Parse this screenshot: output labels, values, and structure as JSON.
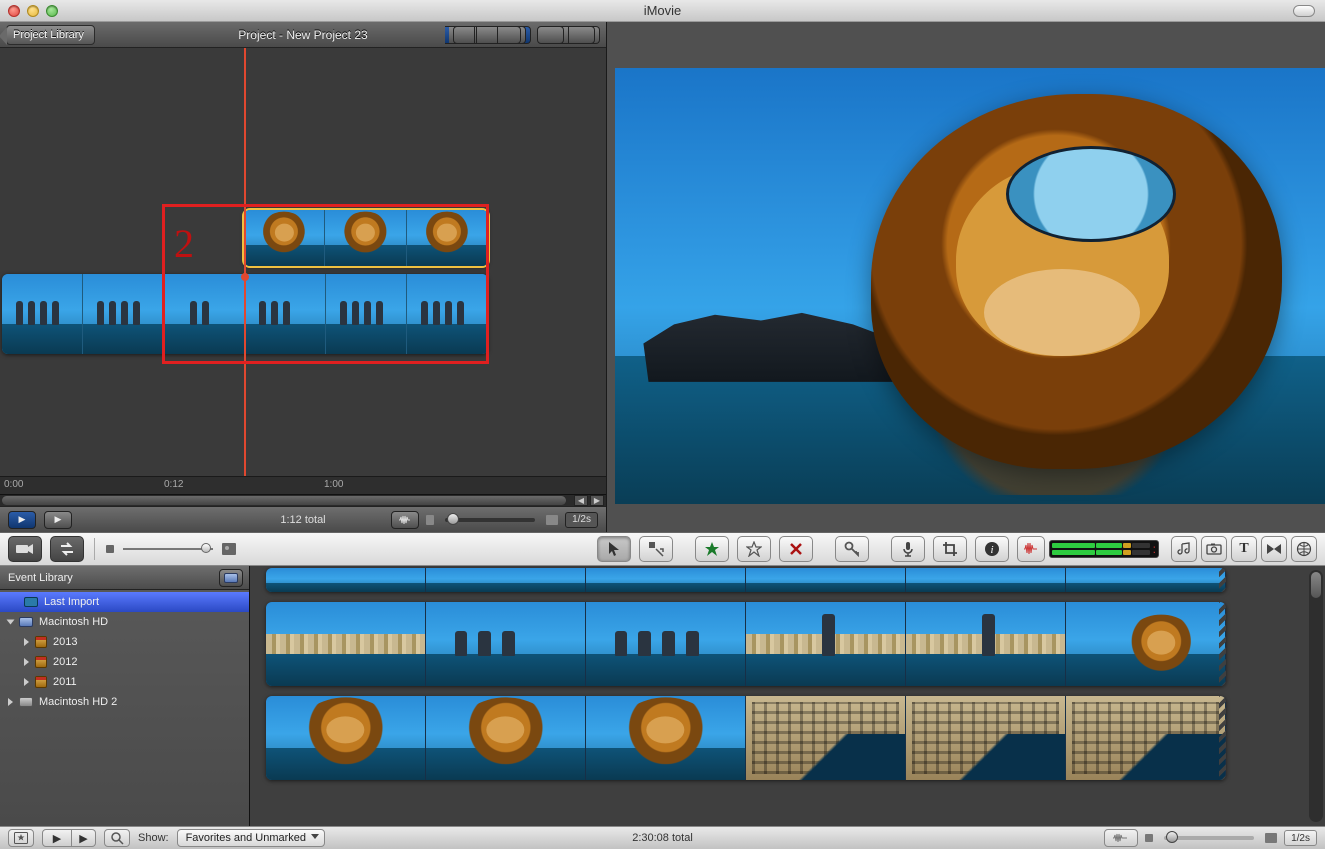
{
  "window": {
    "title": "iMovie"
  },
  "project_header": {
    "back_label": "Project Library",
    "title": "Project - New Project 23"
  },
  "timeline": {
    "ruler": {
      "t0": "0:00",
      "t1": "0:12",
      "t2": "1:00"
    },
    "annotation_number": "2"
  },
  "project_footer": {
    "total_label": "1:12 total",
    "zoom_label": "1/2s"
  },
  "event_sidebar": {
    "title": "Event Library",
    "items": {
      "last_import": "Last Import",
      "mac_hd": "Macintosh HD",
      "y2013": "2013",
      "y2012": "2012",
      "y2011": "2011",
      "mac_hd2": "Macintosh HD 2"
    }
  },
  "bottom_bar": {
    "show_label": "Show:",
    "filter_value": "Favorites and Unmarked",
    "total_label": "2:30:08 total",
    "zoom_label": "1/2s"
  }
}
